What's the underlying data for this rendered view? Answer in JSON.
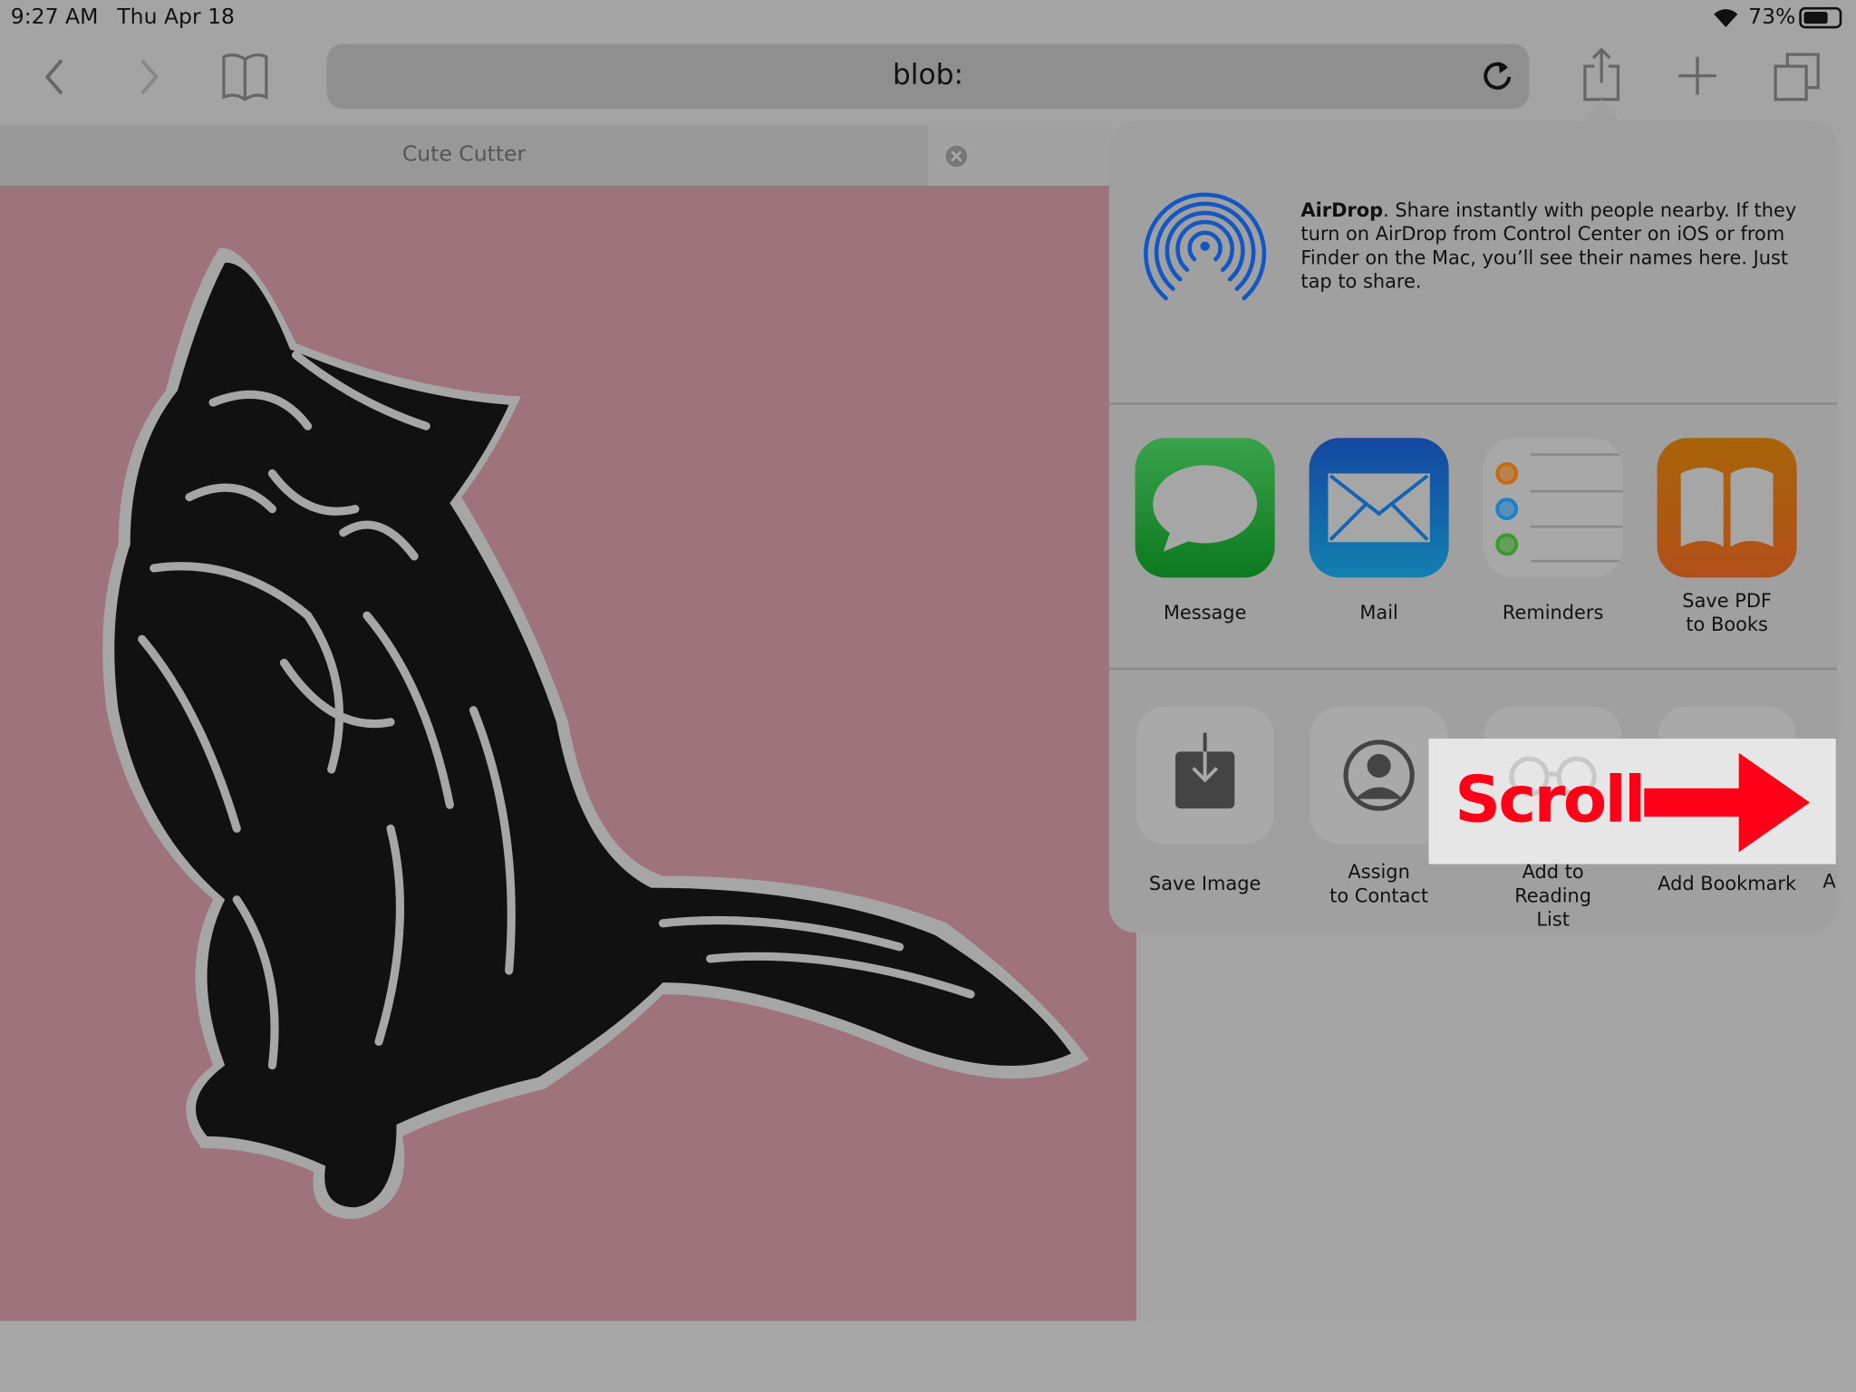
{
  "status_bar": {
    "time": "9:27 AM",
    "date": "Thu Apr 18",
    "battery": "73%",
    "battery_level": 0.73
  },
  "toolbar": {
    "url": "blob:"
  },
  "tab": {
    "title": "Cute Cutter"
  },
  "share_sheet": {
    "airdrop": {
      "title": "AirDrop",
      "description": ". Share instantly with people nearby. If they turn on AirDrop from Control Center on iOS or from Finder on the Mac, you’ll see their names here. Just tap to share."
    },
    "apps": [
      {
        "label": "Message",
        "color": "#1a9a35"
      },
      {
        "label": "Mail",
        "color": "#1564b4"
      },
      {
        "label": "Reminders",
        "color": "#a8a8a8"
      },
      {
        "label": "Save PDF\nto Books",
        "color": "#b25f0e"
      }
    ],
    "actions": [
      {
        "label": "Save Image"
      },
      {
        "label": "Assign\nto Contact"
      },
      {
        "label": "Add to Reading\nList"
      },
      {
        "label": "Add Bookmark"
      },
      {
        "label": "A"
      }
    ]
  },
  "overlay": {
    "text": "Scroll",
    "color": "#ff0018"
  }
}
